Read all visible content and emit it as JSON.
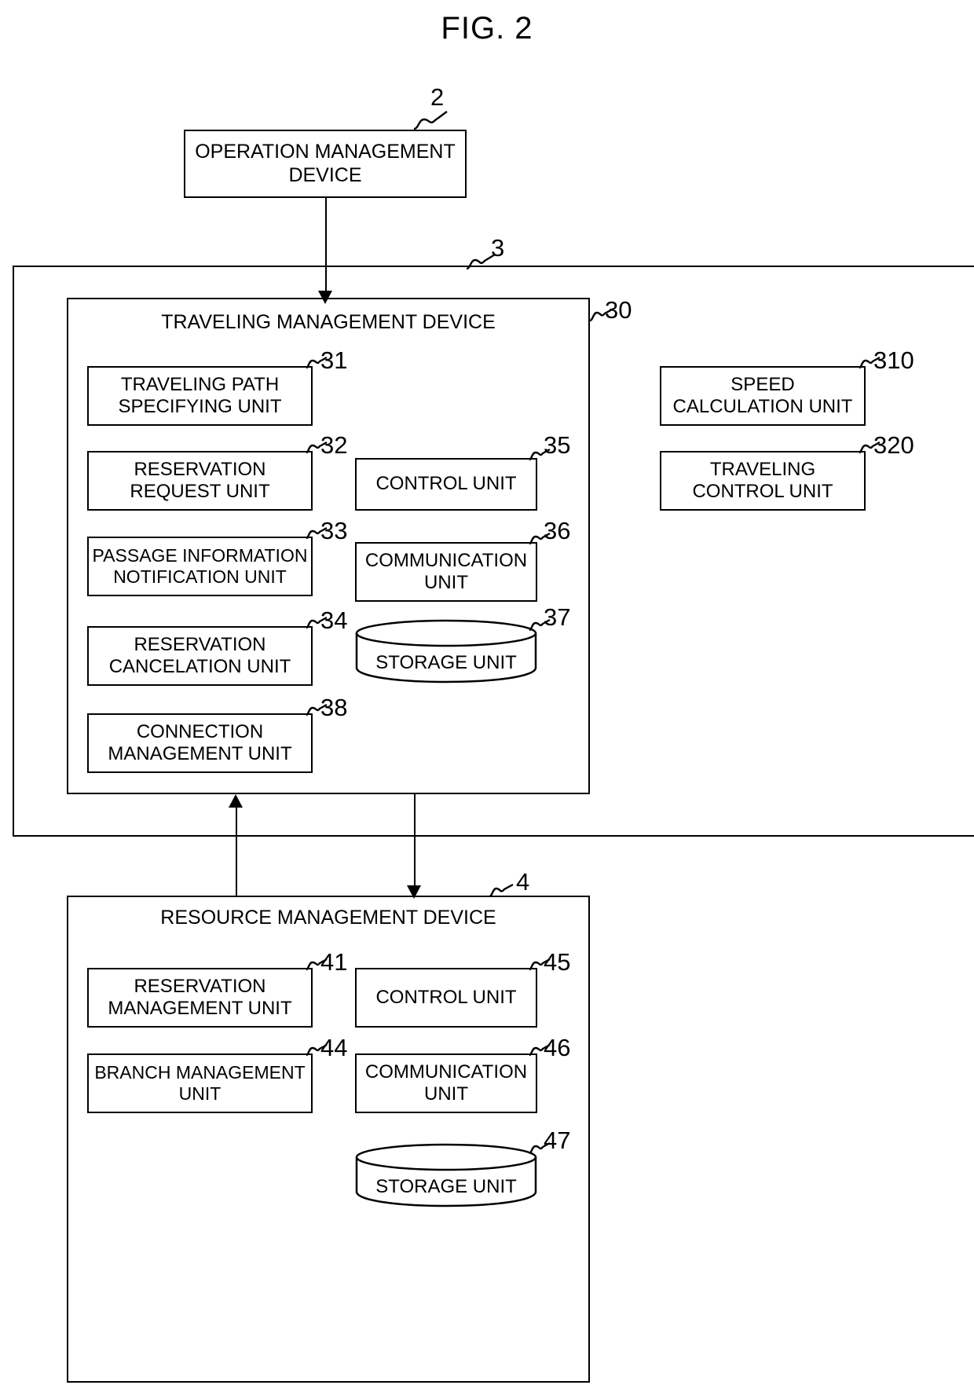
{
  "figure": {
    "title": "FIG. 2"
  },
  "nodes": {
    "operation_management_device": {
      "label": "OPERATION MANAGEMENT\nDEVICE",
      "ref": "2"
    },
    "system_frame": {
      "ref": "3"
    },
    "traveling_management_device": {
      "label": "TRAVELING MANAGEMENT DEVICE",
      "ref": "30"
    },
    "resource_management_device": {
      "label": "RESOURCE MANAGEMENT DEVICE",
      "ref": "4"
    }
  },
  "traveling_units": {
    "left_column": [
      {
        "label": "TRAVELING PATH\nSPECIFYING UNIT",
        "ref": "31"
      },
      {
        "label": "RESERVATION\nREQUEST UNIT",
        "ref": "32"
      },
      {
        "label": "PASSAGE INFORMATION\nNOTIFICATION UNIT",
        "ref": "33"
      },
      {
        "label": "RESERVATION\nCANCELATION UNIT",
        "ref": "34"
      },
      {
        "label": "CONNECTION\nMANAGEMENT UNIT",
        "ref": "38"
      }
    ],
    "middle_column": [
      {
        "label": "CONTROL UNIT",
        "ref": "35"
      },
      {
        "label": "COMMUNICATION\nUNIT",
        "ref": "36"
      },
      {
        "label": "STORAGE UNIT",
        "ref": "37",
        "shape": "cylinder"
      }
    ]
  },
  "vehicle_units": [
    {
      "label": "SPEED\nCALCULATION UNIT",
      "ref": "310"
    },
    {
      "label": "TRAVELING\nCONTROL UNIT",
      "ref": "320"
    }
  ],
  "resource_units": {
    "left_column": [
      {
        "label": "RESERVATION\nMANAGEMENT UNIT",
        "ref": "41"
      },
      {
        "label": "BRANCH MANAGEMENT\nUNIT",
        "ref": "44"
      }
    ],
    "right_column": [
      {
        "label": "CONTROL UNIT",
        "ref": "45"
      },
      {
        "label": "COMMUNICATION\nUNIT",
        "ref": "46"
      },
      {
        "label": "STORAGE UNIT",
        "ref": "47",
        "shape": "cylinder"
      }
    ]
  },
  "connectors": [
    {
      "from": "operation-management-device",
      "to": "traveling-management-device",
      "direction": "down"
    },
    {
      "from": "resource-management-device",
      "to": "traveling-management-device",
      "direction": "up"
    },
    {
      "from": "traveling-management-device",
      "to": "resource-management-device",
      "direction": "down"
    }
  ],
  "style": {
    "line_color": "#000000",
    "background": "#ffffff"
  }
}
